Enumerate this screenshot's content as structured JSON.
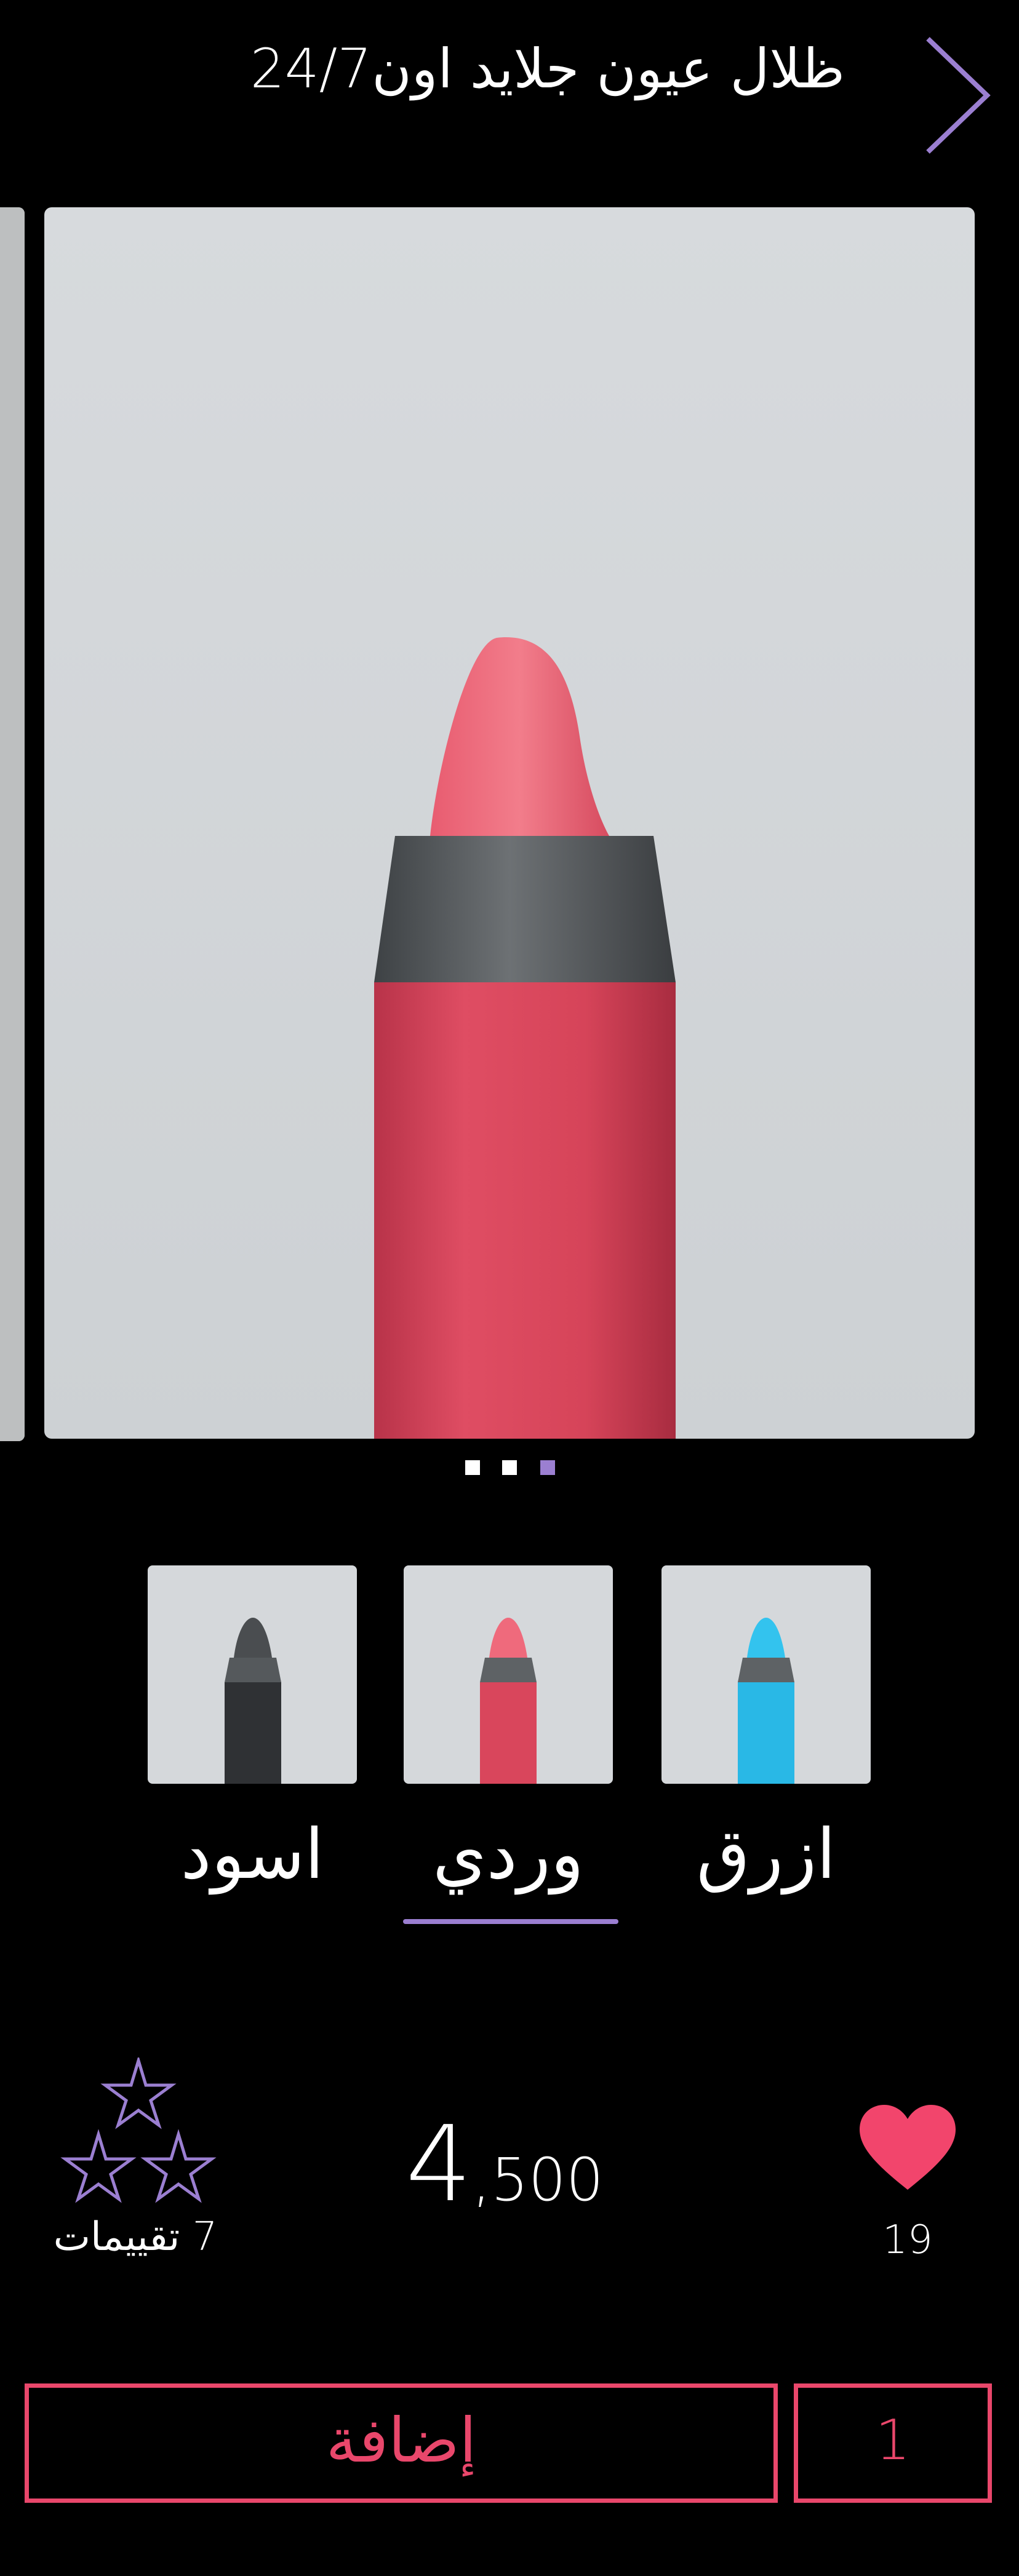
{
  "header": {
    "title": "ظلال عيون جلايد اون24/7",
    "back_icon": "chevron-right-icon"
  },
  "product": {
    "image_alt": "قلم ظلال عيون وردي",
    "slide_count": 3,
    "active_slide_index": 2
  },
  "colors": {
    "accent": "#9b7fd1",
    "primary": "#e9476b",
    "background": "#000000",
    "text": "#ffffff"
  },
  "variants": [
    {
      "label": "ازرق",
      "color": "#29b8e6",
      "selected": false
    },
    {
      "label": "وردي",
      "color": "#df4b63",
      "selected": true
    },
    {
      "label": "اسود",
      "color": "#3a3c3f",
      "selected": false
    }
  ],
  "rating": {
    "stars_icon": "star-icon",
    "star_count": 3,
    "text": "7 تقييمات"
  },
  "price": {
    "main": "4",
    "rest": ",500"
  },
  "likes": {
    "icon": "heart-icon",
    "count": "19"
  },
  "actions": {
    "add_label": "إضافة",
    "quantity": "1"
  }
}
